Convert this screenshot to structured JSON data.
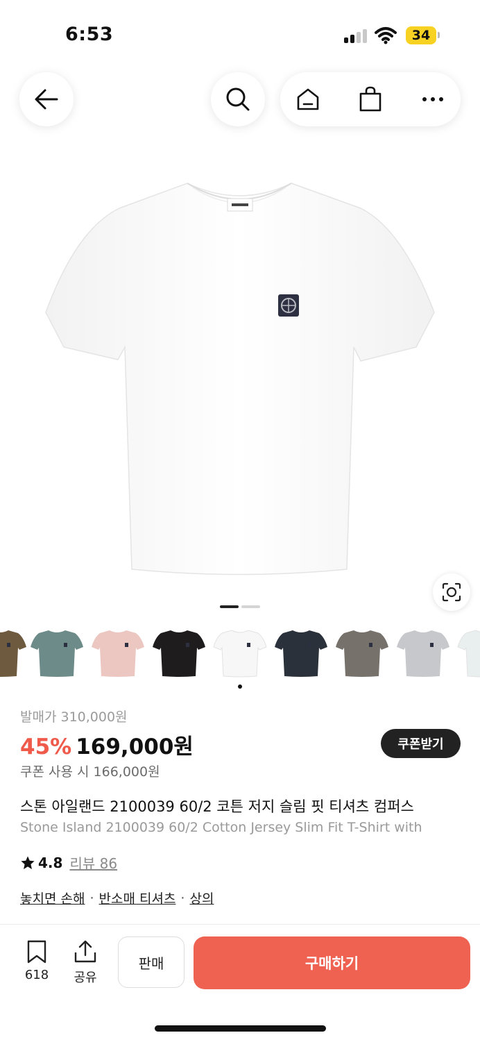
{
  "status_bar": {
    "time": "6:53",
    "battery": "34"
  },
  "nav": {
    "back_icon": "arrow-left-icon",
    "search_icon": "search-icon",
    "home_icon": "home-icon",
    "bag_icon": "shopping-bag-icon",
    "more_icon": "more-dots-icon"
  },
  "gallery": {
    "lens_icon": "image-search-icon",
    "thumbnails": [
      {
        "color": "#6e5a3e",
        "name": "brown"
      },
      {
        "color": "#6d8b88",
        "name": "teal"
      },
      {
        "color": "#ecc7c1",
        "name": "pink"
      },
      {
        "color": "#1e1c1d",
        "name": "black"
      },
      {
        "color": "#f7f7f7",
        "name": "white"
      },
      {
        "color": "#2b313a",
        "name": "navy"
      },
      {
        "color": "#77716c",
        "name": "dove-grey"
      },
      {
        "color": "#c6c8cb",
        "name": "light-grey"
      },
      {
        "color": "#e9eeef",
        "name": "ice"
      }
    ]
  },
  "product": {
    "original_price": "발매가 310,000원",
    "discount": "45%",
    "price": "169,000원",
    "coupon_button": "쿠폰받기",
    "coupon_price": "쿠폰 사용 시 166,000원",
    "title_ko": "스톤 아일랜드 2100039 60/2 코튼 저지 슬림 핏 티셔츠 컴퍼스",
    "title_en": "Stone Island 2100039 60/2 Cotton Jersey Slim Fit T-Shirt with",
    "rating": "4.8",
    "review_link": "리뷰 86",
    "tags": [
      "놓치면 손해",
      "반소매 티셔츠",
      "상의"
    ],
    "tag_separator": "·"
  },
  "bottom_bar": {
    "bookmark_count": "618",
    "share_label": "공유",
    "sell_button": "판매",
    "buy_button": "구매하기"
  },
  "colors": {
    "accent": "#ef5a4b",
    "buy": "#ef6151",
    "dark": "#222222"
  }
}
